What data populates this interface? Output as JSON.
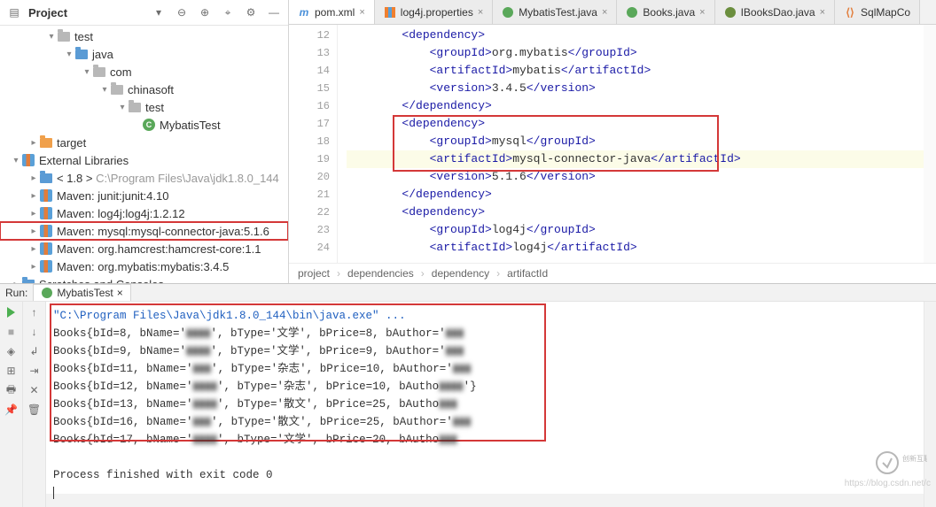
{
  "sidebar": {
    "title": "Project",
    "tree": {
      "test": "test",
      "java": "java",
      "com": "com",
      "chinasoft": "chinasoft",
      "test2": "test",
      "mybatisTest": "MybatisTest",
      "target": "target",
      "extLibs": "External Libraries",
      "jdk": "< 1.8 >",
      "jdkPath": "C:\\Program Files\\Java\\jdk1.8.0_144",
      "mvnJunit": "Maven: junit:junit:4.10",
      "mvnLog4j": "Maven: log4j:log4j:1.2.12",
      "mvnMysql": "Maven: mysql:mysql-connector-java:5.1.6",
      "mvnHamcrest": "Maven: org.hamcrest:hamcrest-core:1.1",
      "mvnMybatis": "Maven: org.mybatis:mybatis:3.4.5",
      "scratches": "Scratches and Consoles"
    }
  },
  "tabs": {
    "pom": "pom.xml",
    "log4j": "log4j.properties",
    "mybatisTest": "MybatisTest.java",
    "books": "Books.java",
    "ibooks": "IBooksDao.java",
    "sqlmap": "SqlMapCo"
  },
  "gutter": [
    "12",
    "13",
    "14",
    "15",
    "16",
    "17",
    "18",
    "19",
    "20",
    "21",
    "22",
    "23",
    "24"
  ],
  "code": {
    "l12": "        <dependency>",
    "l13a": "            <groupId>",
    "l13b": "org.mybatis",
    "l13c": "</groupId>",
    "l14a": "            <artifactId>",
    "l14b": "mybatis",
    "l14c": "</artifactId>",
    "l15a": "            <version>",
    "l15b": "3.4.5",
    "l15c": "</version>",
    "l16": "        </dependency>",
    "l17": "        <dependency>",
    "l18a": "            <groupId>",
    "l18b": "mysql",
    "l18c": "</groupId>",
    "l19a": "            <artifactId>",
    "l19b": "mysql-connector-java",
    "l19c": "</artifactId>",
    "l20a": "            <version>",
    "l20b": "5.1.6",
    "l20c": "</version>",
    "l21": "        </dependency>",
    "l22": "        <dependency>",
    "l23a": "            <groupId>",
    "l23b": "log4j",
    "l23c": "</groupId>",
    "l24a": "            <artifactId>",
    "l24b": "log4j",
    "l24c": "</artifactId>"
  },
  "breadcrumb": {
    "p1": "project",
    "p2": "dependencies",
    "p3": "dependency",
    "p4": "artifactId"
  },
  "run": {
    "label": "Run:",
    "tab": "MybatisTest",
    "cmd": "\"C:\\Program Files\\Java\\jdk1.8.0_144\\bin\\java.exe\" ...",
    "l1a": "Books{bId=8, bName='",
    "l1b": "', bType='文学', bPrice=8, bAuthor='",
    "l2a": "Books{bId=9, bName='",
    "l2b": "', bType='文学', bPrice=9, bAuthor='",
    "l3a": "Books{bId=11, bName='",
    "l3b": "', bType='杂志', bPrice=10, bAuthor='",
    "l4a": "Books{bId=12, bName='",
    "l4b": "', bType='杂志', bPrice=10, bAutho",
    "l4c": "'}",
    "l5a": "Books{bId=13, bName='",
    "l5b": "', bType='散文', bPrice=25, bAutho",
    "l6a": "Books{bId=16, bName='",
    "l6b": "', bType='散文', bPrice=25, bAuthor='",
    "l7a": "Books{bId=17, bName='",
    "l7b": "', bType='文学', bPrice=20, bAutho",
    "exit": "Process finished with exit code 0"
  },
  "watermark": "https://blog.csdn.net/c",
  "logo": "创新互联"
}
